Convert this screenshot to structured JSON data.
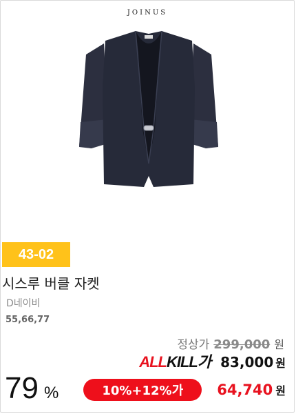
{
  "brand": {
    "name": "JOINUS"
  },
  "product": {
    "image_alt": "navy jacket",
    "code": "43-02",
    "name": "시스루 버클 자켓",
    "color": "D네이비",
    "sizes": "55,66,77"
  },
  "pricing": {
    "regular_label": "정상가",
    "regular_price": "299,000",
    "currency": "원",
    "allkill_logo_red": "ALL",
    "allkill_logo_black": "KILL가",
    "sale_price": "83,000",
    "discount_rate": "79",
    "percent_sign": "%",
    "coupon_label": "10%+12%가",
    "final_price": "64,740"
  },
  "colors": {
    "badge": "#ffc21a",
    "accent_red": "#e8121f",
    "jacket": "#2a2d3d"
  }
}
